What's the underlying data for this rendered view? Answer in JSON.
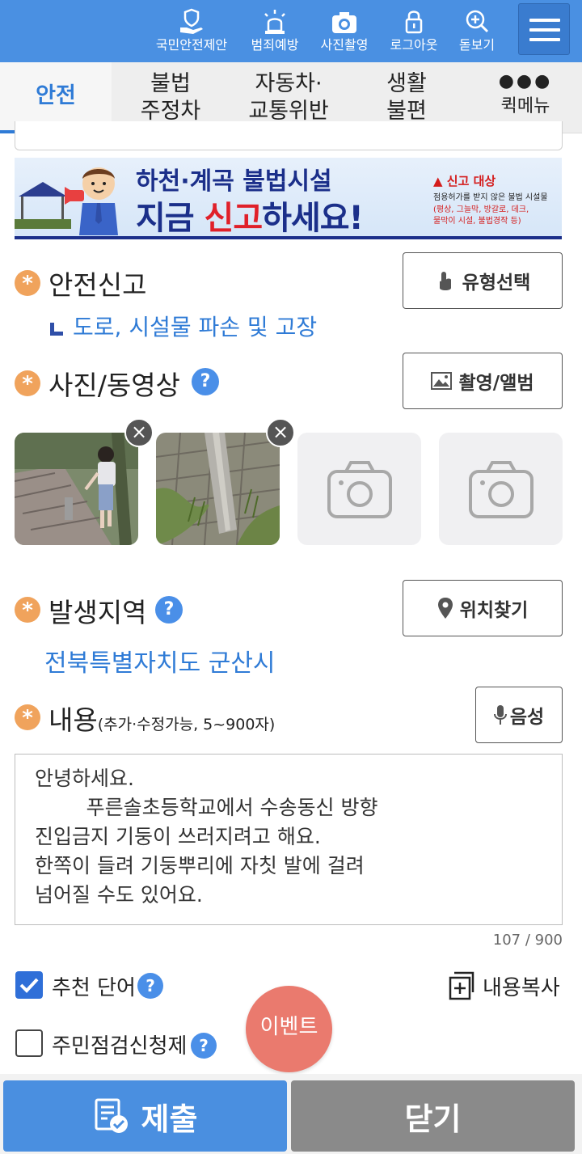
{
  "header": {
    "items": [
      {
        "label": "국민안전제안",
        "icon": "hand-shield-icon"
      },
      {
        "label": "범죄예방",
        "icon": "siren-icon"
      },
      {
        "label": "사진촬영",
        "icon": "camera-icon"
      },
      {
        "label": "로그아웃",
        "icon": "lock-icon"
      },
      {
        "label": "돋보기",
        "icon": "magnifier-icon"
      }
    ],
    "menu_icon": "hamburger-icon",
    "color": "#4a90e2"
  },
  "tabs": [
    {
      "label": "안전",
      "active": true
    },
    {
      "label": "불법\n주정차",
      "active": false
    },
    {
      "label": "자동차·\n교통위반",
      "active": false
    },
    {
      "label": "생활\n불편",
      "active": false
    },
    {
      "label": "퀵메뉴",
      "active": false
    }
  ],
  "banner": {
    "title_line1": "하천·계곡 불법시설",
    "title_line2_a": "지금 ",
    "title_line2_hl": "신고",
    "title_line2_b": "하세요!",
    "warn_title": "신고 대상",
    "warn_line1": "점용허가를 받지 않은 불법 시설물",
    "warn_line2": "(평상, 그늘막, 방갈로, 데크,",
    "warn_line3": "물막이 시설, 불법경작 등)"
  },
  "safety": {
    "title": "안전신고",
    "button": "유형선택",
    "sub_type": "도로, 시설물 파손 및 고장"
  },
  "media": {
    "title": "사진/동영상",
    "button": "촬영/앨범"
  },
  "region": {
    "title": "발생지역",
    "button": "위치찾기",
    "value": "전북특별자치도 군산시"
  },
  "content": {
    "title": "내용",
    "note": "(추가·수정가능, 5~900자)",
    "button": "음성",
    "lines": [
      "안녕하세요.",
      "        푸른솔초등학교에서 수송동신 방향",
      "진입금지 기둥이 쓰러지려고 해요.",
      "한쪽이 들려 기둥뿌리에 자칫 발에 걸려",
      "넘어질 수도 있어요."
    ],
    "counter": "107 / 900"
  },
  "options": {
    "recommend_label": "추천 단어",
    "recommend_checked": true,
    "copy_label": "내용복사",
    "resident_label": "주민점검신청제",
    "resident_checked": false
  },
  "event_label": "이벤트",
  "footer": {
    "submit": "제출",
    "close": "닫기"
  }
}
